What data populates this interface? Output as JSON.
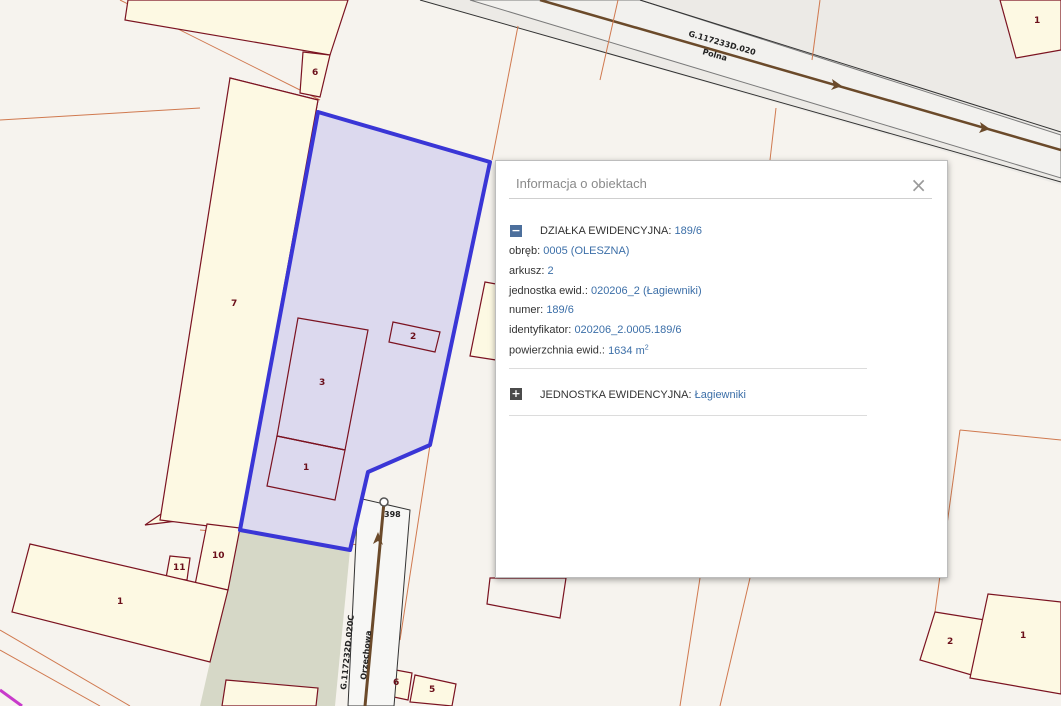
{
  "map": {
    "road_id_top": "G.117233D.020",
    "road_name_top": "Polna",
    "road_id_bottom": "G.117232D.020C",
    "road_name_bottom": "Orzechowa",
    "address_point": "398",
    "parcel_labels": {
      "p6": "6",
      "p7": "7",
      "p10": "10",
      "p11": "11",
      "p1_left": "1",
      "p1_topright": "1",
      "p6_bottom": "6",
      "p5_bottom": "5"
    },
    "building_labels": {
      "b3": "3",
      "b1": "1",
      "b2": "2",
      "br2": "2",
      "br1": "1"
    },
    "colors": {
      "highlight_fill": "#dcd9ee",
      "highlight_border": "#3a36d6",
      "parcel_line": "#d0794f",
      "building_line": "#7b1321",
      "building_fill": "#fdf9e3",
      "green_area": "#d6d8c7"
    }
  },
  "popup": {
    "title": "Informacja o obiektach",
    "close_icon": "close-icon",
    "section1": {
      "toggle": "−",
      "label": "DZIAŁKA EWIDENCYJNA:",
      "value": "189/6",
      "fields": [
        {
          "label": "obręb:",
          "value": "0005 (OLESZNA)"
        },
        {
          "label": "arkusz:",
          "value": "2"
        },
        {
          "label": "jednostka ewid.:",
          "value": "020206_2 (Łagiewniki)"
        },
        {
          "label": "numer:",
          "value": "189/6"
        },
        {
          "label": "identyfikator:",
          "value": "020206_2.0005.189/6"
        },
        {
          "label": "powierzchnia ewid.:",
          "value": "1634 m",
          "unit_sup": "2"
        }
      ]
    },
    "section2": {
      "toggle": "+",
      "label": "JEDNOSTKA EWIDENCYJNA:",
      "value": "Łagiewniki"
    }
  }
}
